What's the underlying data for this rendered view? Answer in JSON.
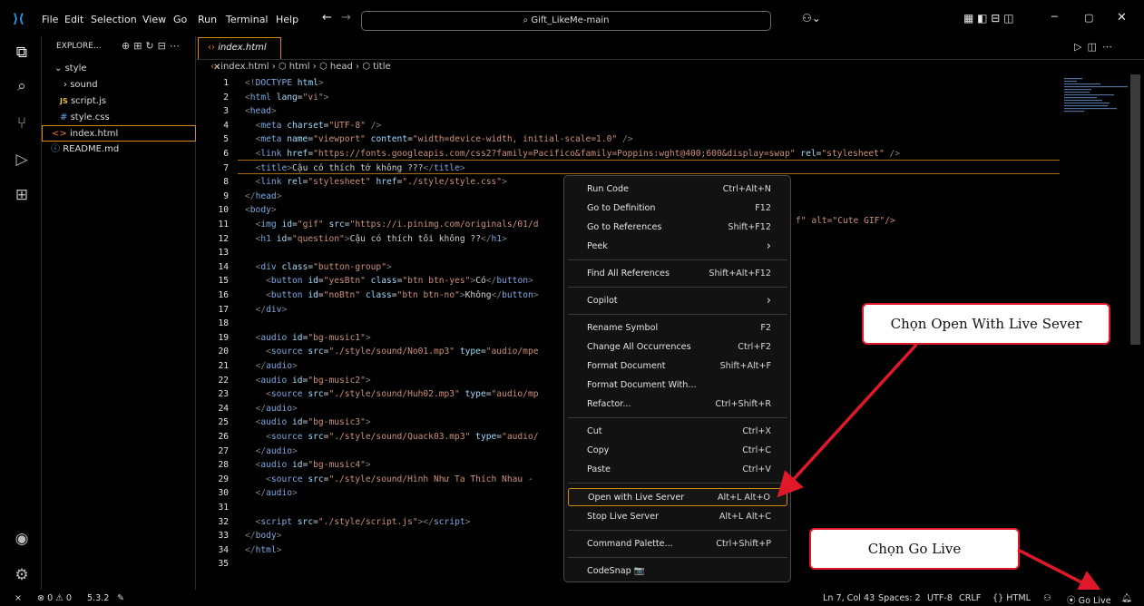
{
  "menubar": {
    "items": [
      "File",
      "Edit",
      "Selection",
      "View",
      "Go",
      "Run",
      "Terminal",
      "Help"
    ],
    "search_text": "Gift_LikeMe-main"
  },
  "sidebar": {
    "title": "EXPLORE...",
    "items": [
      {
        "label": "style",
        "icon": "chevron-down-icon"
      },
      {
        "label": "sound",
        "icon": "chevron-right-icon"
      },
      {
        "label": "script.js",
        "icon": "js-icon",
        "prefix": "JS"
      },
      {
        "label": "style.css",
        "icon": "css-icon",
        "prefix": "#"
      },
      {
        "label": "index.html",
        "icon": "html-icon",
        "prefix": "<>"
      },
      {
        "label": "README.md",
        "icon": "info-icon",
        "prefix": "ⓘ"
      }
    ]
  },
  "editor": {
    "tab_label": "index.html",
    "breadcrumb": [
      "index.html",
      "html",
      "head",
      "title"
    ],
    "lines": [
      {
        "n": "1",
        "html": "<span class=\"p\">&lt;!</span><span class=\"t\">DOCTYPE</span> <span class=\"a\">html</span><span class=\"p\">&gt;</span>"
      },
      {
        "n": "2",
        "html": "<span class=\"p\">&lt;</span><span class=\"t\">html</span> <span class=\"a\">lang</span>=<span class=\"s\">\"vi\"</span><span class=\"p\">&gt;</span>"
      },
      {
        "n": "3",
        "html": "<span class=\"p\">&lt;</span><span class=\"t\">head</span><span class=\"p\">&gt;</span>"
      },
      {
        "n": "4",
        "html": "  <span class=\"p\">&lt;</span><span class=\"t\">meta</span> <span class=\"a\">charset</span>=<span class=\"s\">\"UTF-8\"</span> <span class=\"p\">/&gt;</span>"
      },
      {
        "n": "5",
        "html": "  <span class=\"p\">&lt;</span><span class=\"t\">meta</span> <span class=\"a\">name</span>=<span class=\"s\">\"viewport\"</span> <span class=\"a\">content</span>=<span class=\"s\">\"width=device-width, initial-scale=1.0\"</span> <span class=\"p\">/&gt;</span>"
      },
      {
        "n": "6",
        "html": "  <span class=\"p\">&lt;</span><span class=\"t\">link</span> <span class=\"a\">href</span>=<span class=\"s\">\"https://fonts.googleapis.com/css2?family=Pacifico&amp;family=Poppins:wght@400;600&amp;display=swap\"</span> <span class=\"a\">rel</span>=<span class=\"s\">\"stylesheet\"</span> <span class=\"p\">/&gt;</span>"
      },
      {
        "n": "7",
        "html": "  <span class=\"p\">&lt;</span><span class=\"t\">title</span><span class=\"p\">&gt;</span>Cậu có thích tớ không ???<span class=\"p\">&lt;/</span><span class=\"t\">title</span><span class=\"p\">&gt;</span>"
      },
      {
        "n": "8",
        "html": "  <span class=\"p\">&lt;</span><span class=\"t\">link</span> <span class=\"a\">rel</span>=<span class=\"s\">\"stylesheet\"</span> <span class=\"a\">href</span>=<span class=\"s\">\"./style/style.css\"</span><span class=\"p\">&gt;</span>"
      },
      {
        "n": "9",
        "html": "<span class=\"p\">&lt;/</span><span class=\"t\">head</span><span class=\"p\">&gt;</span>"
      },
      {
        "n": "10",
        "html": "<span class=\"p\">&lt;</span><span class=\"t\">body</span><span class=\"p\">&gt;</span>"
      },
      {
        "n": "11",
        "html": "  <span class=\"p\">&lt;</span><span class=\"t\">img</span> <span class=\"a\">id</span>=<span class=\"s\">\"gif\"</span> <span class=\"a\">src</span>=<span class=\"s\">\"https://i.pinimg.com/originals/01/d</span>"
      },
      {
        "n": "12",
        "html": "  <span class=\"p\">&lt;</span><span class=\"t\">h1</span> <span class=\"a\">id</span>=<span class=\"s\">\"question\"</span><span class=\"p\">&gt;</span>Cậu có thích tôi không ??<span class=\"p\">&lt;/</span><span class=\"t\">h1</span><span class=\"p\">&gt;</span>"
      },
      {
        "n": "13",
        "html": ""
      },
      {
        "n": "14",
        "html": "  <span class=\"p\">&lt;</span><span class=\"t\">div</span> <span class=\"a\">class</span>=<span class=\"s\">\"button-group\"</span><span class=\"p\">&gt;</span>"
      },
      {
        "n": "15",
        "html": "    <span class=\"p\">&lt;</span><span class=\"t\">button</span> <span class=\"a\">id</span>=<span class=\"s\">\"yesBtn\"</span> <span class=\"a\">class</span>=<span class=\"s\">\"btn btn-yes\"</span><span class=\"p\">&gt;</span>Có<span class=\"p\">&lt;/</span><span class=\"t\">button</span><span class=\"p\">&gt;</span>"
      },
      {
        "n": "16",
        "html": "    <span class=\"p\">&lt;</span><span class=\"t\">button</span> <span class=\"a\">id</span>=<span class=\"s\">\"noBtn\"</span> <span class=\"a\">class</span>=<span class=\"s\">\"btn btn-no\"</span><span class=\"p\">&gt;</span>Không<span class=\"p\">&lt;/</span><span class=\"t\">button</span><span class=\"p\">&gt;</span>"
      },
      {
        "n": "17",
        "html": "  <span class=\"p\">&lt;/</span><span class=\"t\">div</span><span class=\"p\">&gt;</span>"
      },
      {
        "n": "18",
        "html": ""
      },
      {
        "n": "19",
        "html": "  <span class=\"p\">&lt;</span><span class=\"t\">audio</span> <span class=\"a\">id</span>=<span class=\"s\">\"bg-music1\"</span><span class=\"p\">&gt;</span>"
      },
      {
        "n": "20",
        "html": "    <span class=\"p\">&lt;</span><span class=\"t\">source</span> <span class=\"a\">src</span>=<span class=\"s\">\"./style/sound/No01.mp3\"</span> <span class=\"a\">type</span>=<span class=\"s\">\"audio/mpe</span>"
      },
      {
        "n": "21",
        "html": "  <span class=\"p\">&lt;/</span><span class=\"t\">audio</span><span class=\"p\">&gt;</span>"
      },
      {
        "n": "22",
        "html": "  <span class=\"p\">&lt;</span><span class=\"t\">audio</span> <span class=\"a\">id</span>=<span class=\"s\">\"bg-music2\"</span><span class=\"p\">&gt;</span>"
      },
      {
        "n": "23",
        "html": "    <span class=\"p\">&lt;</span><span class=\"t\">source</span> <span class=\"a\">src</span>=<span class=\"s\">\"./style/sound/Huh02.mp3\"</span> <span class=\"a\">type</span>=<span class=\"s\">\"audio/mp</span>"
      },
      {
        "n": "24",
        "html": "  <span class=\"p\">&lt;/</span><span class=\"t\">audio</span><span class=\"p\">&gt;</span>"
      },
      {
        "n": "25",
        "html": "  <span class=\"p\">&lt;</span><span class=\"t\">audio</span> <span class=\"a\">id</span>=<span class=\"s\">\"bg-music3\"</span><span class=\"p\">&gt;</span>"
      },
      {
        "n": "26",
        "html": "    <span class=\"p\">&lt;</span><span class=\"t\">source</span> <span class=\"a\">src</span>=<span class=\"s\">\"./style/sound/Quack03.mp3\"</span> <span class=\"a\">type</span>=<span class=\"s\">\"audio/</span>"
      },
      {
        "n": "27",
        "html": "  <span class=\"p\">&lt;/</span><span class=\"t\">audio</span><span class=\"p\">&gt;</span>"
      },
      {
        "n": "28",
        "html": "  <span class=\"p\">&lt;</span><span class=\"t\">audio</span> <span class=\"a\">id</span>=<span class=\"s\">\"bg-music4\"</span><span class=\"p\">&gt;</span>"
      },
      {
        "n": "29",
        "html": "    <span class=\"p\">&lt;</span><span class=\"t\">source</span> <span class=\"a\">src</span>=<span class=\"s\">\"./style/sound/Hình Như Ta Thích Nhau -</span>"
      },
      {
        "n": "30",
        "html": "  <span class=\"p\">&lt;/</span><span class=\"t\">audio</span><span class=\"p\">&gt;</span>"
      },
      {
        "n": "31",
        "html": ""
      },
      {
        "n": "32",
        "html": "  <span class=\"p\">&lt;</span><span class=\"t\">script</span> <span class=\"a\">src</span>=<span class=\"s\">\"./style/script.js\"</span><span class=\"p\">&gt;&lt;/</span><span class=\"t\">script</span><span class=\"p\">&gt;</span>"
      },
      {
        "n": "33",
        "html": "<span class=\"p\">&lt;/</span><span class=\"t\">body</span><span class=\"p\">&gt;</span>"
      },
      {
        "n": "34",
        "html": "<span class=\"p\">&lt;/</span><span class=\"t\">html</span><span class=\"p\">&gt;</span>"
      },
      {
        "n": "35",
        "html": ""
      }
    ],
    "line11_tail": "f\" alt=\"Cute GIF\"/>"
  },
  "context_menu": {
    "items": [
      {
        "label": "Run Code",
        "key": "Ctrl+Alt+N"
      },
      {
        "label": "Go to Definition",
        "key": "F12"
      },
      {
        "label": "Go to References",
        "key": "Shift+F12"
      },
      {
        "label": "Peek",
        "key": "›"
      },
      {
        "label": "Find All References",
        "key": "Shift+Alt+F12"
      },
      {
        "label": "Copilot",
        "key": "›"
      },
      {
        "label": "Rename Symbol",
        "key": "F2"
      },
      {
        "label": "Change All Occurrences",
        "key": "Ctrl+F2"
      },
      {
        "label": "Format Document",
        "key": "Shift+Alt+F"
      },
      {
        "label": "Format Document With...",
        "key": ""
      },
      {
        "label": "Refactor...",
        "key": "Ctrl+Shift+R"
      },
      {
        "label": "Cut",
        "key": "Ctrl+X"
      },
      {
        "label": "Copy",
        "key": "Ctrl+C"
      },
      {
        "label": "Paste",
        "key": "Ctrl+V"
      },
      {
        "label": "Open with Live Server",
        "key": "Alt+L Alt+O"
      },
      {
        "label": "Stop Live Server",
        "key": "Alt+L Alt+C"
      },
      {
        "label": "Command Palette...",
        "key": "Ctrl+Shift+P"
      },
      {
        "label": "CodeSnap 📷",
        "key": ""
      }
    ]
  },
  "callouts": {
    "live_server": "Chọn Open With Live Sever",
    "go_live": "Chọn Go Live"
  },
  "statusbar": {
    "errors": "⊗ 0 ⚠ 0",
    "version": "5.3.2",
    "position": "Ln 7, Col 43",
    "spaces": "Spaces: 2",
    "encoding": "UTF-8",
    "eol": "CRLF",
    "language": "{} HTML",
    "go_live": "Go Live"
  },
  "colors": {
    "accent": "#d18616",
    "callout_border": "#e0192a",
    "arrow": "#e0192a"
  }
}
